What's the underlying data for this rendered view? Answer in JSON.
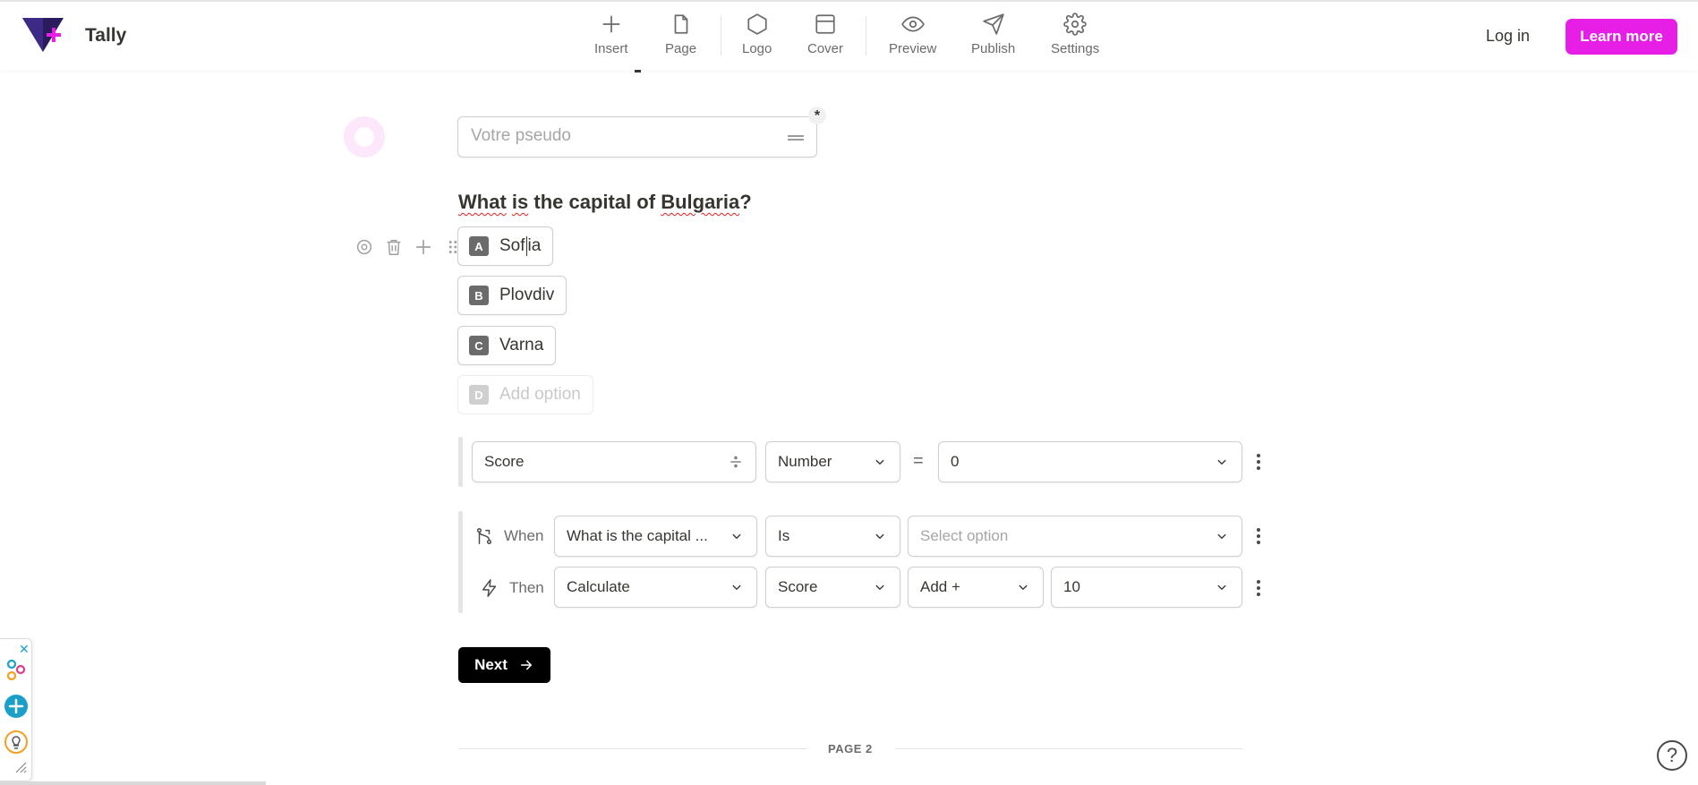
{
  "app": {
    "brand": "Tally"
  },
  "toolbar": {
    "items": [
      {
        "label": "Insert",
        "icon": "plus-icon"
      },
      {
        "label": "Page",
        "icon": "page-icon"
      },
      {
        "label": "Logo",
        "icon": "hexagon-icon"
      },
      {
        "label": "Cover",
        "icon": "cover-icon"
      },
      {
        "label": "Preview",
        "icon": "eye-icon"
      },
      {
        "label": "Publish",
        "icon": "send-icon"
      },
      {
        "label": "Settings",
        "icon": "gear-icon"
      }
    ],
    "login_label": "Log in",
    "learn_more_label": "Learn more"
  },
  "colors": {
    "accent": "#e61ee6",
    "dark": "#000000",
    "text": "#37352f",
    "muted": "#6b6b6b"
  },
  "form": {
    "pseudo": {
      "placeholder": "Votre pseudo",
      "required_mark": "*"
    },
    "question": {
      "prefix": "What",
      "is": "is",
      "mid": "the capital of",
      "country": "Bulgaria",
      "suffix": "?"
    },
    "options": [
      {
        "key": "A",
        "label_before_caret": "Sof",
        "label_after_caret": "ia"
      },
      {
        "key": "B",
        "label": "Plovdiv"
      },
      {
        "key": "C",
        "label": "Varna"
      },
      {
        "key": "D",
        "label": "Add option"
      }
    ],
    "calculated_field": {
      "name": "Score",
      "type": "Number",
      "operator": "=",
      "value": "0"
    },
    "rule": {
      "when_label": "When",
      "when_field": "What is the capital ...",
      "when_operator": "Is",
      "when_value_placeholder": "Select option",
      "then_label": "Then",
      "then_action": "Calculate",
      "then_field": "Score",
      "then_operation": "Add +",
      "then_value": "10"
    },
    "next_label": "Next",
    "page_divider_label": "PAGE 2"
  },
  "help": {
    "label": "?"
  }
}
